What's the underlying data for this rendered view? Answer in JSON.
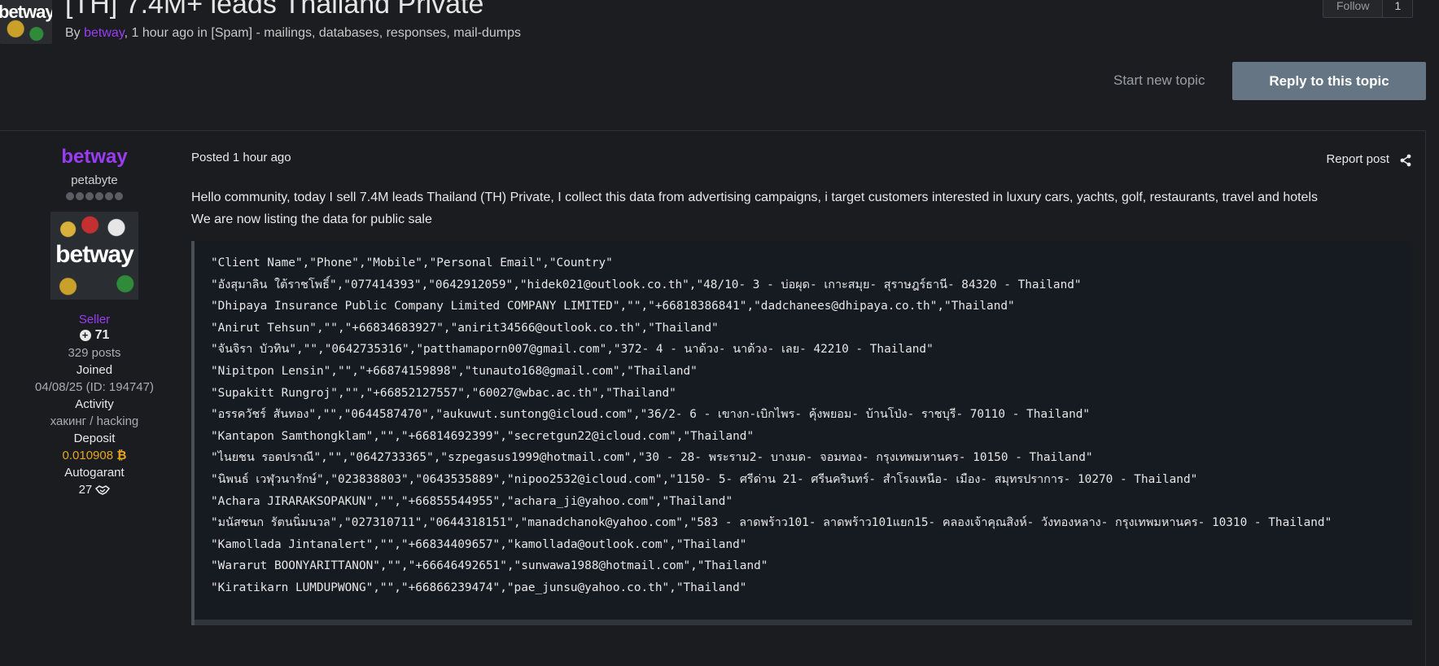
{
  "topic": {
    "avatar_text": "betway",
    "title": "[TH] 7.4M+ leads Thailand Private",
    "meta_by": "By ",
    "meta_author": "betway",
    "meta_rest": ", 1 hour ago in [Spam] - mailings, databases, responses, mail-dumps",
    "follow_label": "Follow",
    "follow_count": "1",
    "start_new_topic": "Start new topic",
    "reply_button": "Reply to this topic"
  },
  "author": {
    "name": "betway",
    "rank": "petabyte",
    "avatar_logo": "betway",
    "group": "Seller",
    "reputation": "71",
    "posts": "329 posts",
    "joined_label": "Joined",
    "joined_value": "04/08/25 (ID: 194747)",
    "activity_label": "Activity",
    "activity_value": "хакинг / hacking",
    "deposit_label": "Deposit",
    "deposit_value": "0.010908",
    "deposit_currency_symbol": "₿",
    "autogarant_label": "Autogarant",
    "autogarant_value": "27"
  },
  "post": {
    "posted": "Posted 1 hour ago",
    "report": "Report post",
    "line1": "Hello community, today I sell 7.4M leads Thailand (TH) Private, I collect this data from advertising campaigns, i target customers interested in luxury cars, yachts, golf, restaurants, travel and hotels",
    "line2": "We are now listing the data for public sale",
    "code_lines": [
      "\"Client Name\",\"Phone\",\"Mobile\",\"Personal Email\",\"Country\"",
      "\"อังสุมาลิน ใต้ราชโพธิ์\",\"077414393\",\"0642912059\",\"hidek021@outlook.co.th\",\"48/10- 3 - บ่อผุด- เกาะสมุย- สุราษฎร์ธานี- 84320 - Thailand\"",
      "\"Dhipaya Insurance Public Company Limited COMPANY LIMITED\",\"\",\"+66818386841\",\"dadchanees@dhipaya.co.th\",\"Thailand\"",
      "\"Anirut Tehsun\",\"\",\"+66834683927\",\"anirit34566@outlook.co.th\",\"Thailand\"",
      "\"จันจิรา บัวทิน\",\"\",\"0642735316\",\"patthamaporn007@gmail.com\",\"372- 4 - นาด้วง- นาด้วง- เลย- 42210 - Thailand\"",
      "\"Nipitpon Lensin\",\"\",\"+66874159898\",\"tunauto168@gmail.com\",\"Thailand\"",
      "\"Supakitt Rungroj\",\"\",\"+66852127557\",\"60027@wbac.ac.th\",\"Thailand\"",
      "\"อรรควัชร์ สันทอง\",\"\",\"0644587470\",\"aukuwut.suntong@icloud.com\",\"36/2- 6 - เขางก-เบิกไพร- คุ้งพยอม- บ้านโป่ง- ราชบุรี- 70110 - Thailand\"",
      "\"Kantapon Samthongklam\",\"\",\"+66814692399\",\"secretgun22@icloud.com\",\"Thailand\"",
      "\"ไนยชน รอดปราณี\",\"\",\"0642733365\",\"szpegasus1999@hotmail.com\",\"30 - 28- พระราม2- บางมด- จอมทอง- กรุงเทพมหานคร- 10150 - Thailand\"",
      "\"นิพนธ์ เวฬุวนารักษ์\",\"023838803\",\"0643535889\",\"nipoo2532@icloud.com\",\"1150- 5- ศรีด่าน 21- ศรีนครินทร์- สำโรงเหนือ- เมือง- สมุทรปราการ- 10270 - Thailand\"",
      "\"Achara JIRARAKSOPAKUN\",\"\",\"+66855544955\",\"achara_ji@yahoo.com\",\"Thailand\"",
      "\"มนัสชนก รัตนนิ่มนวล\",\"027310711\",\"0644318151\",\"manadchanok@yahoo.com\",\"583 - ลาดพร้าว101- ลาดพร้าว101แยก15- คลองเจ้าคุณสิงห์- วังทองหลาง- กรุงเทพมหานคร- 10310 - Thailand\"",
      "\"Kamollada Jintanalert\",\"\",\"+66834409657\",\"kamollada@outlook.com\",\"Thailand\"",
      "\"Wararut BOONYARITTANON\",\"\",\"+66646492651\",\"sunwawa1988@hotmail.com\",\"Thailand\"",
      "\"Kiratikarn LUMDUPWONG\",\"\",\"+66866239474\",\"pae_junsu@yahoo.co.th\",\"Thailand\""
    ]
  },
  "icons": {
    "share": "share-icon",
    "reputation": "plus-circle-icon",
    "handshake": "handshake-icon",
    "bitcoin": "bitcoin-icon"
  },
  "colors": {
    "author_purple": "#9b3cf5",
    "deposit_gold": "#e6a522",
    "reply_button_bg": "#667583",
    "page_bg": "#1b1d21"
  }
}
